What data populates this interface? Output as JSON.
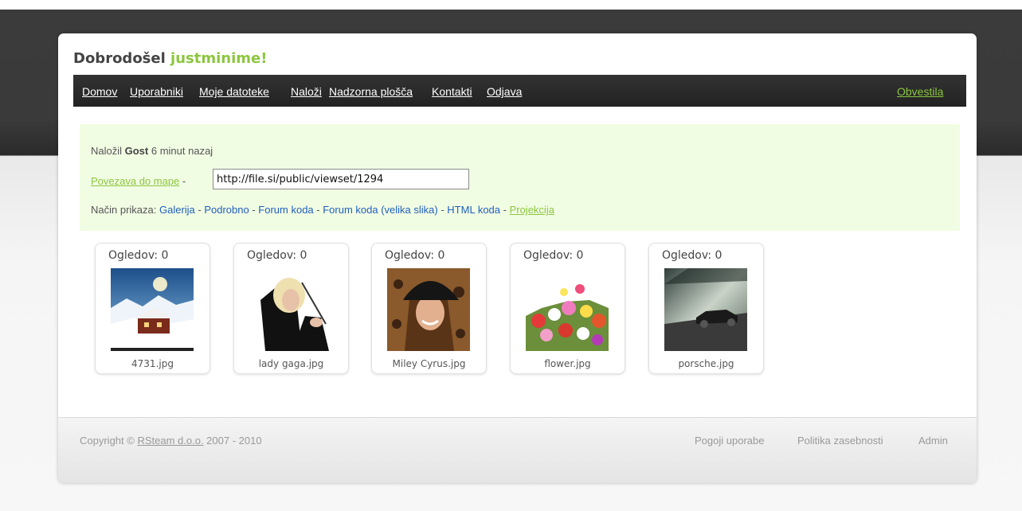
{
  "header": {
    "welcome": "Dobrodošel ",
    "username": "justminime!"
  },
  "nav": {
    "items": [
      "Domov",
      "Uporabniki",
      "Moje datoteke",
      "Naloži",
      "Nadzorna plošča",
      "Kontakti",
      "Odjava"
    ],
    "notifications": "Obvestila"
  },
  "info": {
    "uploaded_prefix": "Naložil ",
    "uploader": "Gost",
    "uploaded_suffix": " 6 minut nazaj",
    "folder_link": "Povezava do mape",
    "dash": " - ",
    "folder_url": "http://file.si/public/viewset/1294",
    "view_mode_label": "Način prikaza: ",
    "view_modes": [
      "Galerija",
      "Podrobno",
      "Forum koda",
      "Forum koda (velika slika)",
      "HTML koda",
      "Projekcija"
    ],
    "active_view_mode": "Projekcija"
  },
  "thumbnails": [
    {
      "views": "Ogledov: 0",
      "filename": "4731.jpg",
      "icon": "winter-cabin-image"
    },
    {
      "views": "Ogledov: 0",
      "filename": "lady gaga.jpg",
      "icon": "portrait-image"
    },
    {
      "views": "Ogledov: 0",
      "filename": "Miley Cyrus.jpg",
      "icon": "portrait-image"
    },
    {
      "views": "Ogledov: 0",
      "filename": "flower.jpg",
      "icon": "flowers-image"
    },
    {
      "views": "Ogledov: 0",
      "filename": "porsche.jpg",
      "icon": "car-image"
    }
  ],
  "footer": {
    "copyright_prefix": "Copyright © ",
    "company": "RSteam d.o.o.",
    "years": " 2007 - 2010",
    "links": [
      "Pogoji uporabe",
      "Politika zasebnosti",
      "Admin"
    ]
  },
  "colors": {
    "accent": "#8cc63f",
    "link_blue": "#1f5fbf",
    "info_bg": "#f1fde3",
    "nav_bg": "#2b2b2b"
  }
}
